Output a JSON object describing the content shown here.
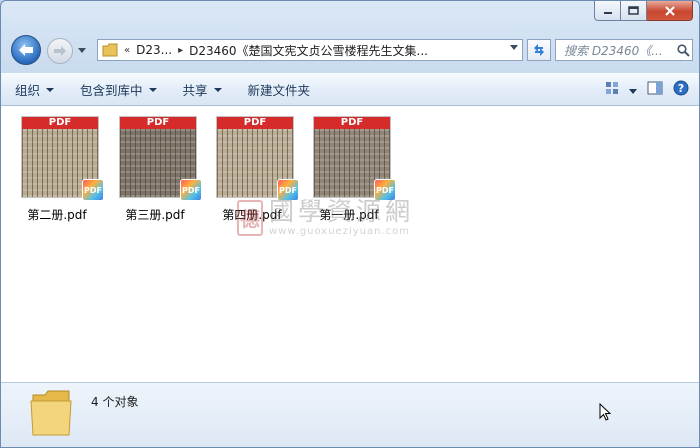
{
  "window": {
    "caption": {
      "minimize": "minimize",
      "maximize": "maximize",
      "close": "close"
    }
  },
  "nav": {
    "crumb_prefix": "«",
    "crumb_1": "D23...",
    "crumb_2": "D23460《楚国文宪文贞公雪楼程先生文集...",
    "search_placeholder": "搜索 D23460《...",
    "icons": {
      "back": "back-arrow-icon",
      "forward": "forward-arrow-icon",
      "refresh": "refresh-icon",
      "search": "search-icon"
    }
  },
  "toolbar": {
    "organize": "组织",
    "include_library": "包含到库中",
    "share": "共享",
    "new_folder": "新建文件夹",
    "icons": {
      "view": "view-options-icon",
      "preview": "preview-pane-icon",
      "help": "help-icon"
    }
  },
  "files": [
    {
      "name": "第二册.pdf",
      "band": "PDF",
      "badge": "PDF",
      "tone": "#b7ab92"
    },
    {
      "name": "第三册.pdf",
      "band": "PDF",
      "badge": "PDF",
      "tone": "#7c7468"
    },
    {
      "name": "第四册.pdf",
      "band": "PDF",
      "badge": "PDF",
      "tone": "#b9ad96"
    },
    {
      "name": "第一册.pdf",
      "band": "PDF",
      "badge": "PDF",
      "tone": "#8f8578"
    }
  ],
  "watermark": {
    "seal": "德",
    "text": "國學資源網",
    "url": "www.guoxueziyuan.com"
  },
  "details": {
    "count": "4 个对象"
  }
}
